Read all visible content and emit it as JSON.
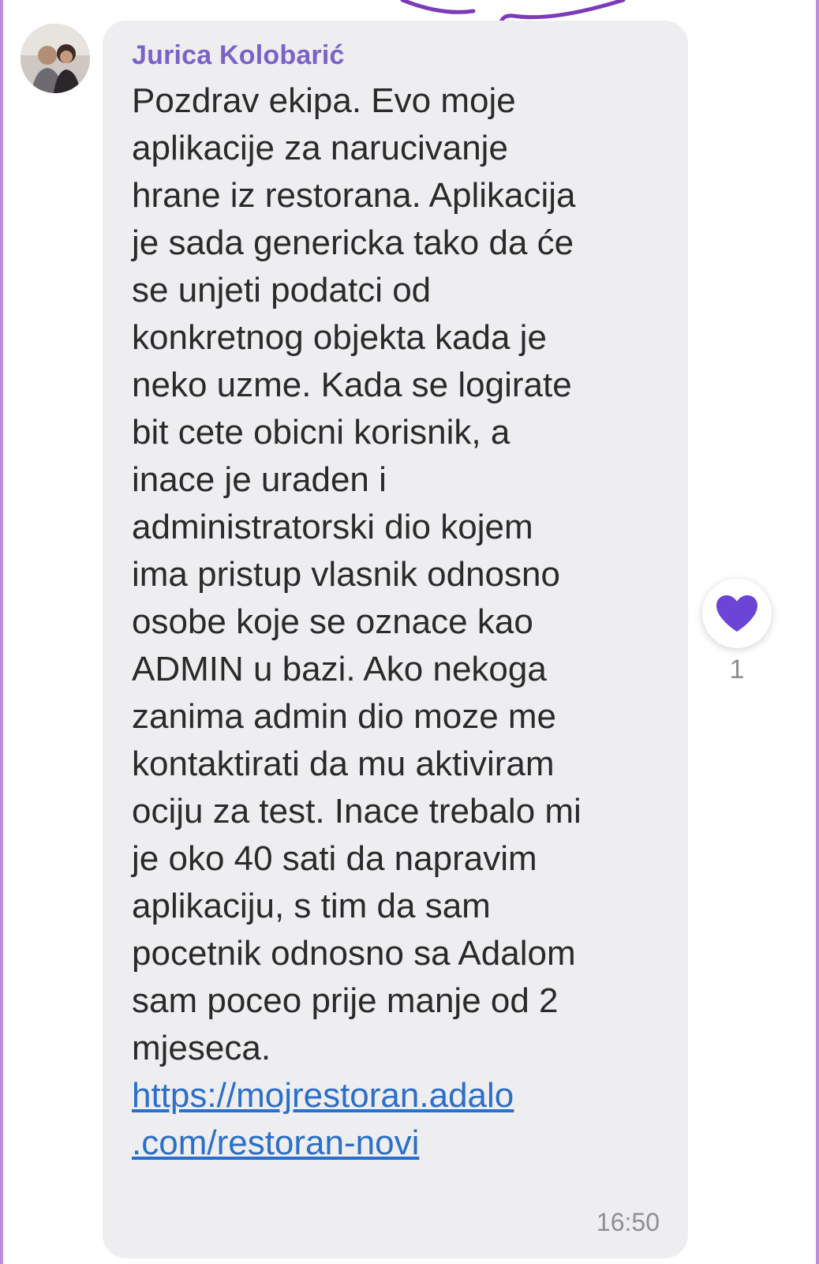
{
  "message": {
    "sender": "Jurica Kolobarić",
    "lines": [
      "Pozdrav ekipa. Evo moje",
      "aplikacije za narucivanje",
      "hrane iz restorana. Aplikacija",
      "je sada genericka tako da će",
      "se unjeti podatci od",
      "konkretnog objekta kada je",
      "neko uzme. Kada se logirate",
      "bit cete obicni korisnik, a",
      "inace je uraden i",
      "administratorski dio kojem",
      "ima pristup vlasnik odnosno",
      "osobe koje se oznace kao",
      "ADMIN u bazi. Ako nekoga",
      "zanima admin dio moze me",
      "kontaktirati da mu aktiviram",
      "ociju za test. Inace trebalo mi",
      "je oko 40 sati da napravim",
      "aplikaciju, s tim da sam",
      "pocetnik odnosno sa Adalom",
      "sam poceo prije manje od 2",
      "mjeseca."
    ],
    "link_lines": [
      "https://mojrestoran.adalo",
      ".com/restoran-novi"
    ],
    "time": "16:50"
  },
  "reaction": {
    "icon": "heart-icon",
    "count": "1",
    "color": "#6a45d6"
  },
  "colors": {
    "bubble": "#eeedf0",
    "sender": "#7a62c8",
    "link": "#2a6fc9",
    "accent": "#8b45c9"
  }
}
